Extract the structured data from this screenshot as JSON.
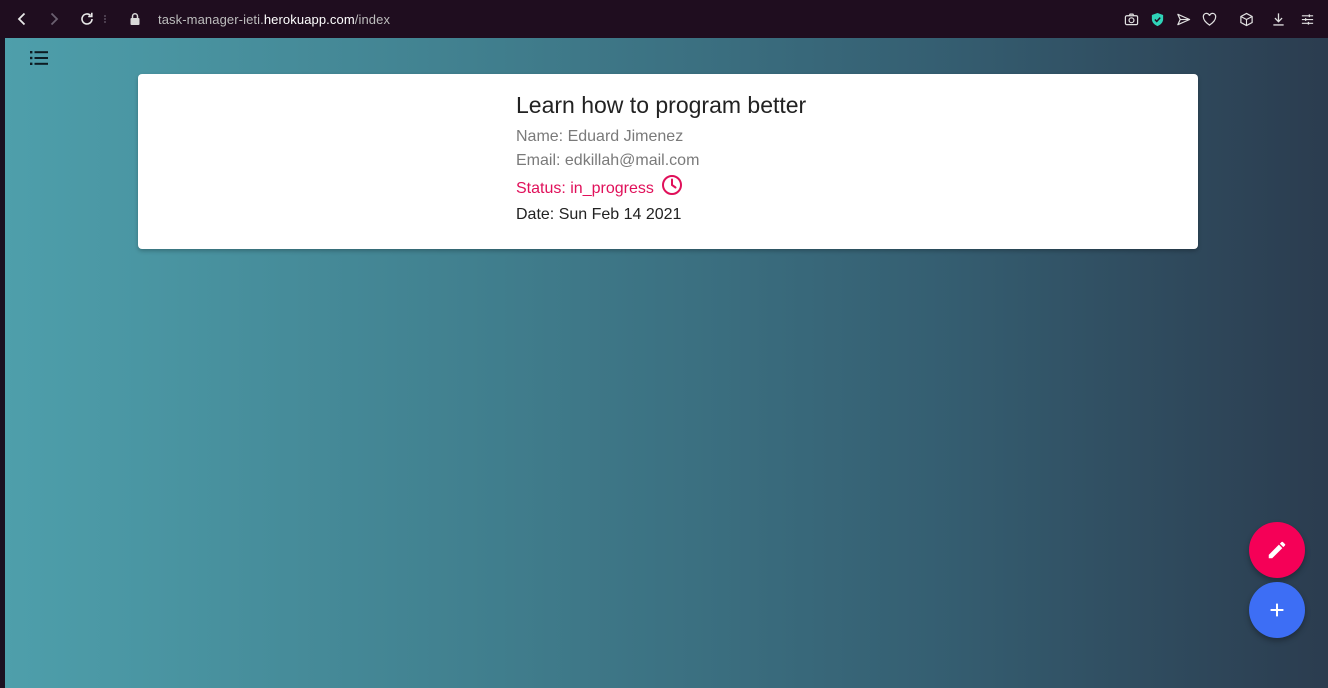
{
  "browser": {
    "url_prefix": "task-manager-ieti.",
    "url_host": "herokuapp.com",
    "url_path": "/index"
  },
  "task": {
    "title": "Learn how to program better",
    "name_label": "Name: Eduard Jimenez",
    "email_label": "Email: edkillah@mail.com",
    "status_label": "Status: in_progress",
    "date_label": "Date: Sun Feb 14 2021",
    "status_icon": "clock-icon"
  },
  "colors": {
    "status": "#e0105a",
    "edit_fab": "#f50057",
    "add_fab": "#3d6ef5",
    "browser_bar": "#1f0d1f"
  },
  "fabs": {
    "edit_icon": "pencil-icon",
    "add_icon": "plus-icon"
  }
}
